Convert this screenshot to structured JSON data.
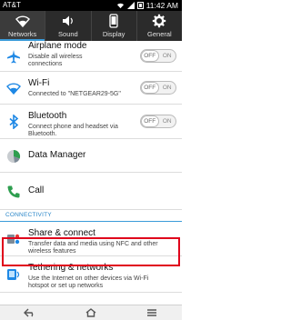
{
  "status_bar": {
    "carrier": "AT&T",
    "time": "11:42 AM"
  },
  "tabs": [
    {
      "label": "Networks",
      "icon": "wifi-icon",
      "active": true
    },
    {
      "label": "Sound",
      "icon": "speaker-icon",
      "active": false
    },
    {
      "label": "Display",
      "icon": "phone-icon",
      "active": false
    },
    {
      "label": "General",
      "icon": "gear-icon",
      "active": false
    }
  ],
  "settings": {
    "airplane": {
      "title": "Airplane mode",
      "desc1": "Disable all wireless",
      "desc2": "connections",
      "toggle_off": "OFF",
      "toggle_on": "ON"
    },
    "wifi": {
      "title": "Wi-Fi",
      "desc1": "Connected to \"NETGEAR29-5G\"",
      "toggle_off": "OFF",
      "toggle_on": "ON"
    },
    "bluetooth": {
      "title": "Bluetooth",
      "desc1": "Connect phone and headset via",
      "desc2": "Bluetooth.",
      "toggle_off": "OFF",
      "toggle_on": "ON"
    },
    "data_manager": {
      "title": "Data Manager"
    },
    "call": {
      "title": "Call"
    },
    "section_connectivity": "CONNECTIVITY",
    "share": {
      "title": "Share & connect",
      "desc1": "Transfer data and media using NFC and other",
      "desc2": "wireless features"
    },
    "tethering": {
      "title": "Tethering & networks",
      "desc1": "Use the Internet on other devices via Wi-Fi",
      "desc2": "hotspot or set up networks"
    }
  },
  "colors": {
    "accent": "#3a9bd9",
    "highlight": "#e0001b",
    "wifi_icon": "#1e88e5"
  }
}
